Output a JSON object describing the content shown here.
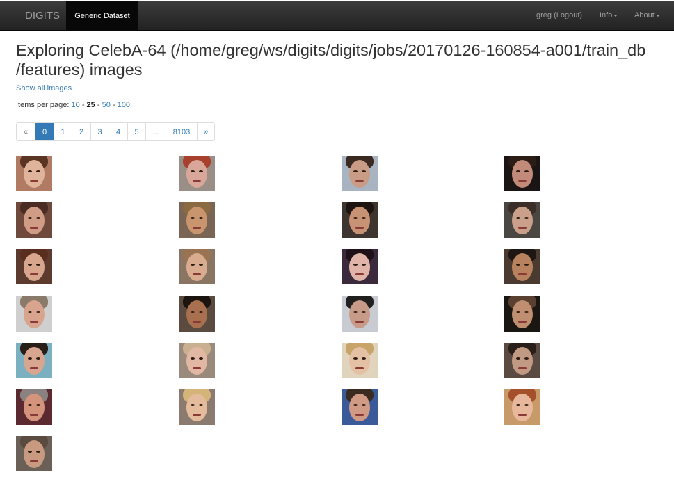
{
  "navbar": {
    "brand": "DIGITS",
    "active_tab": "Generic Dataset",
    "user": "greg (Logout)",
    "info": "Info",
    "about": "About"
  },
  "page": {
    "title_line1": "Exploring CelebA-64 (/home/greg/ws/digits/digits/jobs/20170126-160854-a001/train_db",
    "title_line2": "/features) images",
    "show_all": "Show all images"
  },
  "items_per_page": {
    "label": "Items per page:",
    "options": [
      "10",
      "25",
      "50",
      "100"
    ],
    "selected": "25",
    "separator": "-"
  },
  "pagination": {
    "prev": "«",
    "pages": [
      "0",
      "1",
      "2",
      "3",
      "4",
      "5",
      "...",
      "8103"
    ],
    "current": "0",
    "next": "»"
  },
  "images": [
    {
      "bg": "#b07a63",
      "skin": "#e0b49b",
      "hair": "#5a3524"
    },
    {
      "bg": "#9a8f86",
      "skin": "#d9a79a",
      "hair": "#a8402e"
    },
    {
      "bg": "#a9b4c2",
      "skin": "#c99c86",
      "hair": "#3b2a22"
    },
    {
      "bg": "#1a1414",
      "skin": "#c28a78",
      "hair": "#2c1c16"
    },
    {
      "bg": "#6f4a3c",
      "skin": "#d09c86",
      "hair": "#4a2c22"
    },
    {
      "bg": "#7a6454",
      "skin": "#c9956e",
      "hair": "#8a6a40"
    },
    {
      "bg": "#3e3430",
      "skin": "#c89274",
      "hair": "#1c1410"
    },
    {
      "bg": "#4a4642",
      "skin": "#caa08a",
      "hair": "#3a2e26"
    },
    {
      "bg": "#5c3a2e",
      "skin": "#d8a68c",
      "hair": "#5a2e1e"
    },
    {
      "bg": "#8a7462",
      "skin": "#d9ac90",
      "hair": "#9a7452"
    },
    {
      "bg": "#3a2a3c",
      "skin": "#e0b4a8",
      "hair": "#1e1218"
    },
    {
      "bg": "#4a3a30",
      "skin": "#b8825e",
      "hair": "#1e1612"
    },
    {
      "bg": "#cfcfd0",
      "skin": "#d8a48e",
      "hair": "#8a7a6a"
    },
    {
      "bg": "#5a4a40",
      "skin": "#a8704e",
      "hair": "#1c140e"
    },
    {
      "bg": "#c8ccd2",
      "skin": "#c89a88",
      "hair": "#22201e"
    },
    {
      "bg": "#1a1612",
      "skin": "#c08e70",
      "hair": "#5a4030"
    },
    {
      "bg": "#7ab0c0",
      "skin": "#d8a690",
      "hair": "#2a1e18"
    },
    {
      "bg": "#9a8a7c",
      "skin": "#e2b8a4",
      "hair": "#c8b090"
    },
    {
      "bg": "#e0d4bc",
      "skin": "#e4c0a4",
      "hair": "#c8a468"
    },
    {
      "bg": "#5a4a42",
      "skin": "#c29a84",
      "hair": "#2a1e18"
    },
    {
      "bg": "#5a2a30",
      "skin": "#d4947c",
      "hair": "#8a8280"
    },
    {
      "bg": "#8a7a70",
      "skin": "#e4bc9c",
      "hair": "#d4b478"
    },
    {
      "bg": "#3a5a9a",
      "skin": "#d09a84",
      "hair": "#3a2a20"
    },
    {
      "bg": "#c89a6a",
      "skin": "#e8b89c",
      "hair": "#a4502a"
    },
    {
      "bg": "#6a6058",
      "skin": "#c89a80",
      "hair": "#5a4a40"
    }
  ]
}
